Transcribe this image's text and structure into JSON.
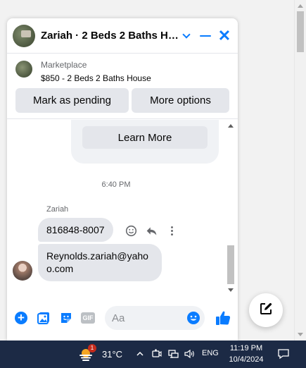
{
  "chat": {
    "title": "Zariah · 2 Beds 2 Baths Ho...",
    "marketplace_label": "Marketplace",
    "listing": "$850 - 2 Beds 2 Baths House",
    "mark_pending_label": "Mark as pending",
    "more_options_label": "More options",
    "learn_more_label": "Learn More",
    "timestamp": "6:40 PM",
    "sender_name": "Zariah",
    "messages": [
      {
        "text": "816848-8007"
      },
      {
        "text": "Reynolds.zariah@yahoo.com"
      }
    ],
    "composer_placeholder": "Aa"
  },
  "colors": {
    "accent": "#0a7cff",
    "bubble": "#e4e6eb",
    "taskbar": "#1c2a45"
  },
  "icons": {
    "header": [
      "chevron-down-icon",
      "minimize-icon",
      "close-icon"
    ],
    "message_actions": [
      "react-icon",
      "reply-icon",
      "more-icon"
    ],
    "composer": [
      "plus-icon",
      "photo-icon",
      "sticker-icon",
      "gif-icon",
      "emoji-icon",
      "like-icon"
    ],
    "floating": "new-message-icon"
  },
  "taskbar": {
    "notification_count": "1",
    "temperature": "31°C",
    "language": "ENG",
    "time": "11:19 PM",
    "date": "10/4/2024"
  }
}
